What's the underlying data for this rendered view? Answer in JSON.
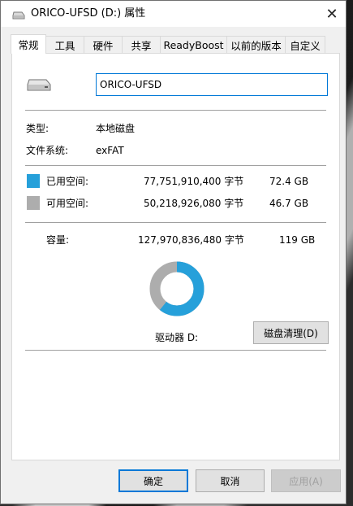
{
  "window": {
    "title": "ORICO-UFSD (D:) 属性",
    "close_glyph": "✕"
  },
  "tabs": [
    {
      "label": "常规",
      "active": true
    },
    {
      "label": "工具",
      "active": false
    },
    {
      "label": "硬件",
      "active": false
    },
    {
      "label": "共享",
      "active": false
    },
    {
      "label": "ReadyBoost",
      "active": false
    },
    {
      "label": "以前的版本",
      "active": false
    },
    {
      "label": "自定义",
      "active": false
    }
  ],
  "general": {
    "drive_name": "ORICO-UFSD",
    "type_label": "类型:",
    "type_value": "本地磁盘",
    "fs_label": "文件系统:",
    "fs_value": "exFAT",
    "used_label": "已用空间:",
    "used_bytes": "77,751,910,400 字节",
    "used_gb": "72.4 GB",
    "free_label": "可用空间:",
    "free_bytes": "50,218,926,080 字节",
    "free_gb": "46.7 GB",
    "capacity_label": "容量:",
    "capacity_bytes": "127,970,836,480 字节",
    "capacity_gb": "119 GB",
    "drive_letter_label": "驱动器 D:",
    "cleanup_button": "磁盘清理(D)",
    "used_fraction": 0.6076
  },
  "colors": {
    "used": "#26a0da",
    "free": "#adadad",
    "accent": "#0078d7"
  },
  "footer": {
    "ok": "确定",
    "cancel": "取消",
    "apply": "应用(A)"
  }
}
